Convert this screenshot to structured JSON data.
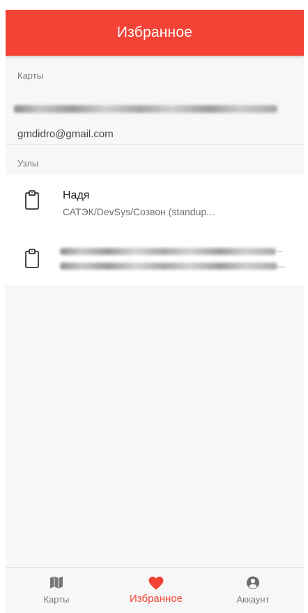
{
  "header": {
    "title": "Избранное"
  },
  "sections": {
    "maps_label": "Карты",
    "nodes_label": "Узлы"
  },
  "map_card": {
    "email": "gmdidro@gmail.com"
  },
  "nodes": [
    {
      "title": "Надя",
      "subtitle": "САТЭК/DevSys/Созвон (standup..."
    },
    {
      "title_ellipsis": "..",
      "subtitle_ellipsis": "..."
    }
  ],
  "bottom_nav": {
    "items": [
      {
        "label": "Карты",
        "icon": "map-icon"
      },
      {
        "label": "Избранное",
        "icon": "heart-icon",
        "active": true
      },
      {
        "label": "Аккаунт",
        "icon": "account-circle-icon"
      }
    ]
  },
  "colors": {
    "accent": "#f44336",
    "background": "#f7f7f7"
  }
}
